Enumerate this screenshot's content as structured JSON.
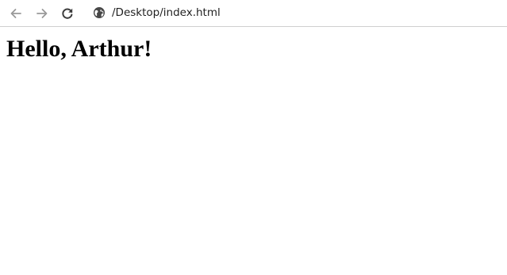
{
  "browser": {
    "url": "/Desktop/index.html",
    "icons": {
      "back": "arrow-left-icon",
      "forward": "arrow-right-icon",
      "reload": "reload-icon",
      "site_info": "globe-icon"
    },
    "colors": {
      "icon_active": "#3c3c3c",
      "icon_disabled": "#9a9a9a"
    }
  },
  "page": {
    "heading": "Hello, Arthur!"
  }
}
